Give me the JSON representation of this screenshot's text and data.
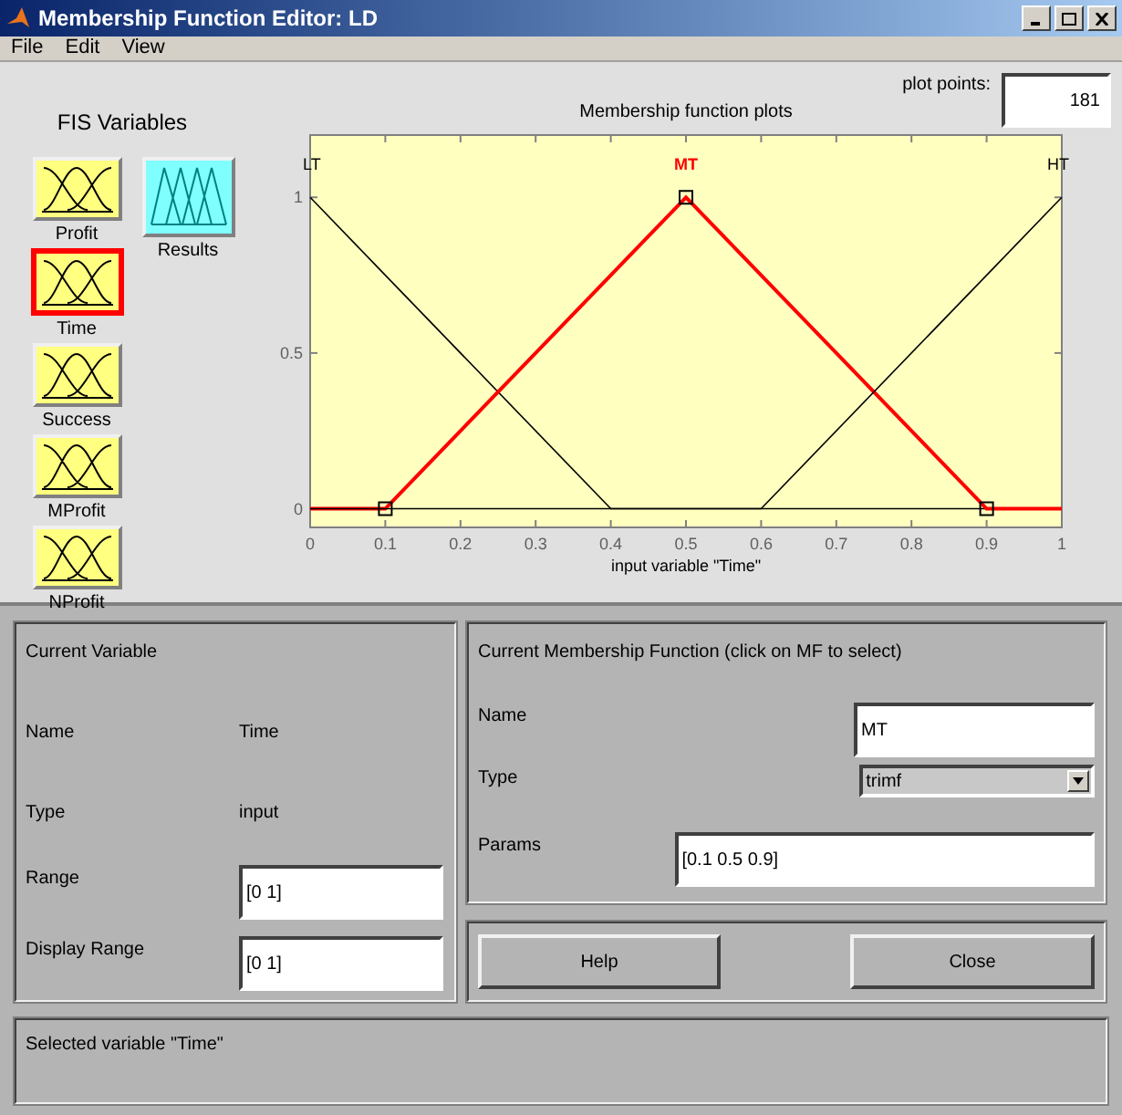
{
  "window": {
    "title": "Membership Function Editor: LD"
  },
  "menu": [
    "File",
    "Edit",
    "View"
  ],
  "fis_variables": {
    "title": "FIS Variables",
    "items": [
      {
        "name": "Profit",
        "kind": "input",
        "selected": false
      },
      {
        "name": "Time",
        "kind": "input",
        "selected": true
      },
      {
        "name": "Success",
        "kind": "input",
        "selected": false
      },
      {
        "name": "MProfit",
        "kind": "input",
        "selected": false
      },
      {
        "name": "NProfit",
        "kind": "input",
        "selected": false
      },
      {
        "name": "Results",
        "kind": "output",
        "selected": false
      }
    ]
  },
  "plot_points": {
    "label": "plot points:",
    "value": "181"
  },
  "plot": {
    "title": "Membership function plots",
    "membership_functions": [
      {
        "selected": false
      },
      {
        "selected": true
      },
      {
        "selected": false
      }
    ],
    "chart_data": {
      "type": "line",
      "xlabel": "input variable \"Time\"",
      "x": [
        0,
        0.1,
        0.4,
        0.5,
        0.6,
        0.9,
        1
      ],
      "series": [
        {
          "name": "LT",
          "color": "#000000",
          "values": [
            1,
            0.75,
            0,
            0,
            0,
            0,
            0
          ]
        },
        {
          "name": "MT",
          "color": "#ff0000",
          "values": [
            0,
            0,
            0.75,
            1,
            0.75,
            0,
            0
          ]
        },
        {
          "name": "HT",
          "color": "#000000",
          "values": [
            0,
            0,
            0,
            0,
            0,
            0.75,
            1
          ]
        }
      ],
      "xlim": [
        0,
        1
      ],
      "ylim": [
        -0.06,
        1.2
      ],
      "xticks": [
        0,
        0.1,
        0.2,
        0.3,
        0.4,
        0.5,
        0.6,
        0.7,
        0.8,
        0.9,
        1
      ],
      "yticks": [
        0,
        0.5,
        1
      ]
    }
  },
  "current_variable": {
    "title": "Current Variable",
    "name_label": "Name",
    "name": "Time",
    "type_label": "Type",
    "type": "input",
    "range_label": "Range",
    "range": "[0 1]",
    "display_range_label": "Display Range",
    "display_range": "[0 1]"
  },
  "current_mf": {
    "title": "Current Membership Function (click on MF to select)",
    "name_label": "Name",
    "name": "MT",
    "type_label": "Type",
    "type": "trimf",
    "params_label": "Params",
    "params": "[0.1 0.5 0.9]"
  },
  "buttons": [
    "Help",
    "Close"
  ],
  "status": "Selected variable \"Time\""
}
